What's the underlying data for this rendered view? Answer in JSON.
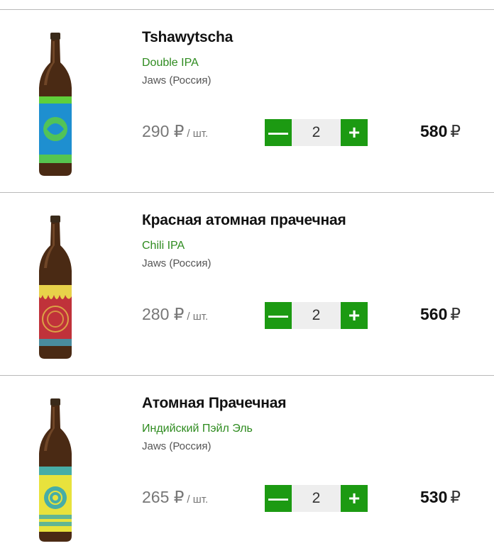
{
  "currency_symbol": "₽",
  "unit_label": "/ шт.",
  "minus_label": "—",
  "plus_label": "+",
  "colors": {
    "accent_green": "#1c9a12",
    "style_text_green": "#2e8b1f"
  },
  "items": [
    {
      "name": "Tshawytscha",
      "style": "Double IPA",
      "brewery": "Jaws (Россия)",
      "price": "290",
      "quantity": "2",
      "total": "580",
      "label_color": "#1e8fd0",
      "label_accent": "#5fcf3a"
    },
    {
      "name": "Красная атомная прачечная",
      "style": "Chili IPA",
      "brewery": "Jaws (Россия)",
      "price": "280",
      "quantity": "2",
      "total": "560",
      "label_color": "#c0323a",
      "label_accent": "#e8d24a"
    },
    {
      "name": "Атомная Прачечная",
      "style": "Индийский Пэйл Эль",
      "brewery": "Jaws (Россия)",
      "price": "265",
      "quantity": "2",
      "total": "530",
      "label_color": "#e8e23c",
      "label_accent": "#2aa3b8"
    }
  ]
}
